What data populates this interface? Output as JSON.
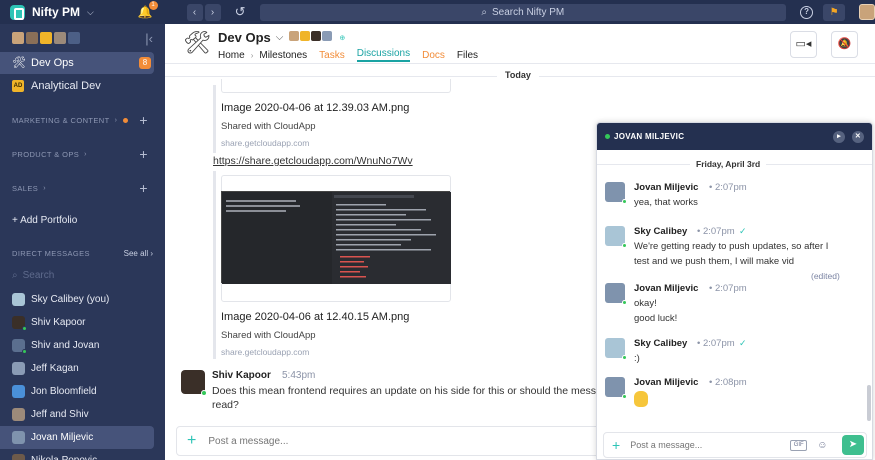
{
  "app": {
    "name": "Nifty PM",
    "notification_count": "1"
  },
  "topbar": {
    "search_placeholder": "Search Nifty PM"
  },
  "sidebar": {
    "projects": [
      {
        "label": "Dev Ops",
        "badge": "8",
        "active": true,
        "icon": "tools-icon"
      },
      {
        "label": "Analytical Dev",
        "icon_text": "AD"
      }
    ],
    "sections": [
      {
        "label": "MARKETING & CONTENT"
      },
      {
        "label": "PRODUCT & OPS"
      },
      {
        "label": "SALES"
      }
    ],
    "add_portfolio": "+ Add Portfolio",
    "dm_header": "DIRECT MESSAGES",
    "see_all": "See all",
    "dm_search_placeholder": "Search",
    "dms": [
      {
        "label": "Sky Calibey (you)",
        "color": "#a9c5d6"
      },
      {
        "label": "Shiv Kapoor",
        "color": "#3a2f28"
      },
      {
        "label": "Shiv and Jovan",
        "color": "#5b6f8f"
      },
      {
        "label": "Jeff Kagan",
        "color": "#8a9bb5"
      },
      {
        "label": "Jon Bloomfield",
        "color": "#4a90d9"
      },
      {
        "label": "Jeff and Shiv",
        "color": "#9c8a7a"
      },
      {
        "label": "Jovan Miljevic",
        "color": "#7f93ad",
        "active": true
      },
      {
        "label": "Nikola Popovic",
        "color": "#6d5a4a"
      }
    ]
  },
  "project": {
    "title": "Dev Ops",
    "tabs": [
      {
        "label": "Home",
        "style": "plain"
      },
      {
        "label": "Milestones",
        "style": "plain"
      },
      {
        "label": "Tasks",
        "style": "orange"
      },
      {
        "label": "Discussions",
        "style": "active"
      },
      {
        "label": "Docs",
        "style": "orange"
      },
      {
        "label": "Files",
        "style": "plain"
      }
    ]
  },
  "feed": {
    "date_divider": "Today",
    "attachments": [
      {
        "title": "Image 2020-04-06 at 12.39.03 AM.png",
        "shared": "Shared with CloudApp",
        "link": "share.getcloudapp.com"
      },
      {
        "title": "Image 2020-04-06 at 12.40.15 AM.png",
        "shared": "Shared with CloudApp",
        "link": "share.getcloudapp.com"
      }
    ],
    "share_url": "https://share.getcloudapp.com/WnuNo7Wv",
    "message": {
      "author": "Shiv Kapoor",
      "time": "5:43pm",
      "text": "Does this mean frontend requires an update on his side for this or should the mess read?"
    },
    "composer_placeholder": "Post a message..."
  },
  "dm_panel": {
    "title": "JOVAN MILJEVIC",
    "date_divider": "Friday, April 3rd",
    "messages": [
      {
        "author": "Jovan Miljevic",
        "time": "2:07pm",
        "lines": [
          "yea, that works"
        ],
        "color": "#7f93ad"
      },
      {
        "author": "Sky Calibey",
        "time": "2:07pm",
        "read": true,
        "lines": [
          "We're getting ready to push updates, so after I",
          "test and we push them, I will make vid"
        ],
        "edited": "(edited)",
        "color": "#a9c5d6"
      },
      {
        "author": "Jovan Miljevic",
        "time": "2:07pm",
        "lines": [
          "okay!",
          "good luck!"
        ],
        "color": "#7f93ad"
      },
      {
        "author": "Sky Calibey",
        "time": "2:07pm",
        "read": true,
        "lines": [
          ":)"
        ],
        "color": "#a9c5d6"
      },
      {
        "author": "Jovan Miljevic",
        "time": "2:08pm",
        "lines": [],
        "emoji": "crossed-fingers-emoji",
        "color": "#7f93ad"
      }
    ],
    "composer_placeholder": "Post a message...",
    "gif_label": "GIF"
  },
  "colors": {
    "sidebar_bg": "#2b3759",
    "topbar_bg": "#243050",
    "accent_orange": "#f28c38",
    "accent_teal": "#1aa3a3",
    "send_green": "#3fbf8f"
  }
}
